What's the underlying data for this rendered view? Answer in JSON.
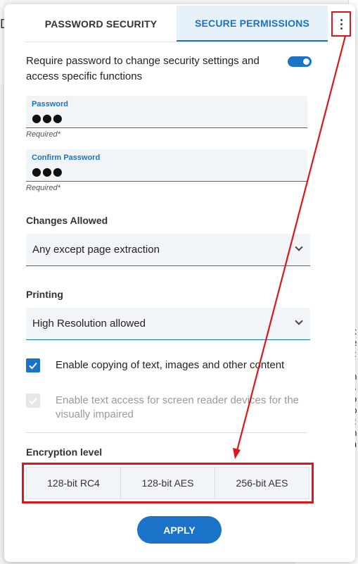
{
  "tabs": [
    {
      "label": "PASSWORD SECURITY",
      "active": false
    },
    {
      "label": "SECURE PERMISSIONS",
      "active": true
    }
  ],
  "more_button_icon": "more-vertical-icon",
  "require_password": {
    "text": "Require password to change security settings and access specific functions",
    "enabled": true
  },
  "password": {
    "label": "Password",
    "value": "●●●",
    "helper": "Required*"
  },
  "confirm_password": {
    "label": "Confirm Password",
    "value": "●●●",
    "helper": "Required*"
  },
  "changes_allowed": {
    "label": "Changes Allowed",
    "selected": "Any except page extraction"
  },
  "printing": {
    "label": "Printing",
    "selected": "High Resolution allowed"
  },
  "enable_copying": {
    "text": "Enable copying of text, images and other content",
    "checked": true
  },
  "enable_screen_reader": {
    "text": "Enable text access for screen reader devices for the visually impaired",
    "checked": true,
    "disabled": true
  },
  "encryption": {
    "label": "Encryption level",
    "options": [
      "128-bit RC4",
      "128-bit AES",
      "256-bit AES"
    ]
  },
  "apply_label": "APPLY",
  "background": {
    "left_char": "D",
    "right_chars": [
      "k",
      "e",
      "c",
      "t",
      "h",
      "s",
      "o",
      "p",
      "c",
      "h",
      "a",
      "t"
    ]
  },
  "colors": {
    "accent": "#1a73c8",
    "annotation": "#e0151a"
  }
}
